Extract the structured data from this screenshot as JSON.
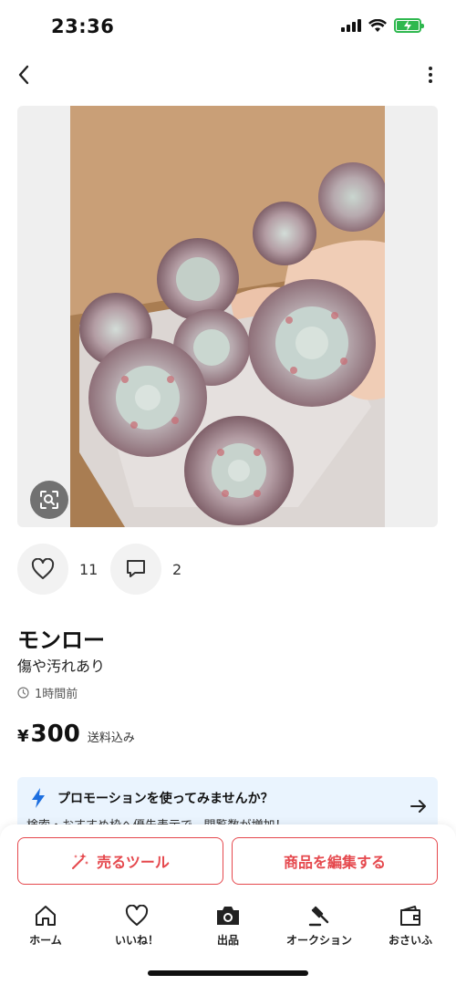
{
  "status_bar": {
    "time": "23:36"
  },
  "product": {
    "likes_count": "11",
    "comments_count": "2",
    "title": "モンロー",
    "condition": "傷や汚れあり",
    "posted": "1時間前",
    "price_currency": "¥",
    "price": "300",
    "price_note": "送料込み"
  },
  "promo": {
    "title": "プロモーションを使ってみませんか？",
    "subtitle": "検索・おすすめ枠へ優先表示で、閲覧数が増加！"
  },
  "actions": {
    "sell_tool": "売るツール",
    "edit_item": "商品を編集する"
  },
  "tabs": [
    {
      "label": "ホーム",
      "icon": "home-icon"
    },
    {
      "label": "いいね！",
      "icon": "heart-icon"
    },
    {
      "label": "出品",
      "icon": "camera-icon"
    },
    {
      "label": "オークション",
      "icon": "gavel-icon"
    },
    {
      "label": "おさいふ",
      "icon": "wallet-icon"
    }
  ],
  "colors": {
    "accent": "#e5484d",
    "promo_bg": "#eaf4fe",
    "promo_bolt": "#1d6fe0",
    "battery": "#2fb84f"
  }
}
